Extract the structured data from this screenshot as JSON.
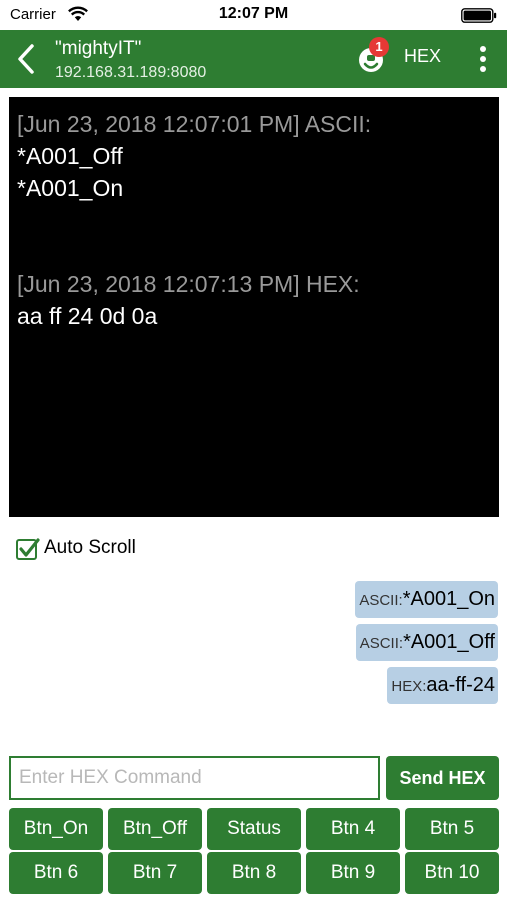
{
  "status_bar": {
    "carrier": "Carrier",
    "time": "12:07 PM"
  },
  "nav": {
    "title": "\"mightyIT\"",
    "subtitle": "192.168.31.189:8080",
    "badge_count": "1",
    "mode_label": "HEX"
  },
  "console": {
    "lines": [
      {
        "kind": "ts",
        "text": "[Jun 23, 2018 12:07:01 PM] ASCII:"
      },
      {
        "kind": "msg",
        "text": "*A001_Off"
      },
      {
        "kind": "msg",
        "text": "*A001_On"
      },
      {
        "kind": "ts",
        "text": "[Jun 23, 2018 12:07:13 PM] HEX:"
      },
      {
        "kind": "msg",
        "text": "aa ff 24 0d 0a"
      }
    ]
  },
  "auto_scroll": {
    "label": "Auto Scroll",
    "checked": true
  },
  "history": [
    {
      "type": "ASCII:",
      "value": "*A001_On"
    },
    {
      "type": "ASCII:",
      "value": "*A001_Off"
    },
    {
      "type": "HEX:",
      "value": "aa-ff-24"
    }
  ],
  "command": {
    "placeholder": "Enter HEX Command",
    "value": "",
    "send_label": "Send HEX"
  },
  "buttons": [
    "Btn_On",
    "Btn_Off",
    "Status",
    "Btn 4",
    "Btn 5",
    "Btn 6",
    "Btn 7",
    "Btn 8",
    "Btn 9",
    "Btn 10"
  ],
  "colors": {
    "accent": "#2e7d32",
    "badge": "#e53935",
    "chip": "#b7cfe4",
    "console_bg": "#000000",
    "timestamp": "#999999"
  }
}
